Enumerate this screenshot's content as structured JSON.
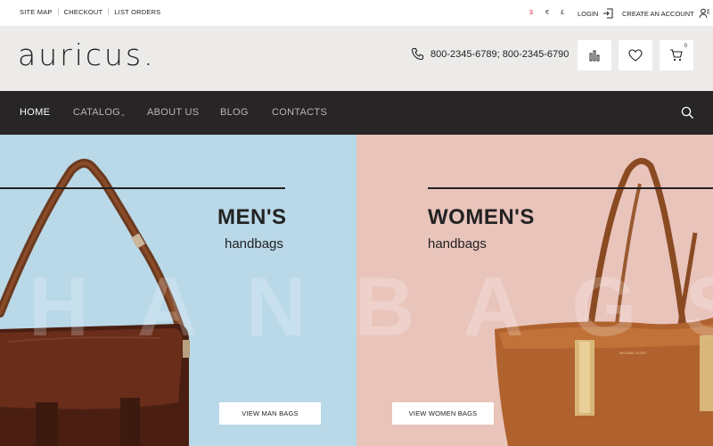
{
  "topbar": {
    "links": [
      "SITE MAP",
      "CHECKOUT",
      "LIST ORDERS"
    ],
    "currencies": [
      "$",
      "€",
      "£"
    ],
    "login_label": "LOGIN",
    "create_account_label": "CREATE AN ACCOUNT"
  },
  "header": {
    "logo": "auricus.",
    "phone": "800-2345-6789; 800-2345-6790",
    "cart_count": "0",
    "icons": [
      "phone-icon",
      "compare-icon",
      "wishlist-heart-icon",
      "cart-icon"
    ]
  },
  "nav": {
    "items": [
      "HOME",
      "CATALOG",
      "ABOUT US",
      "BLOG",
      "CONTACTS"
    ],
    "active": "HOME"
  },
  "hero": {
    "watermark": "HANBAGS",
    "men": {
      "title": "MEN'S",
      "subtitle": "handbags",
      "button": "VIEW MAN BAGS"
    },
    "women": {
      "title": "WOMEN'S",
      "subtitle": "handbags",
      "button": "VIEW WOMEN BAGS"
    }
  },
  "colors": {
    "accent_currency": "#e0506a",
    "nav_bg": "#282526",
    "header_bg": "#ecebe9",
    "hero_left_bg": "#b9d8e8",
    "hero_right_bg": "#e9c4bb"
  }
}
